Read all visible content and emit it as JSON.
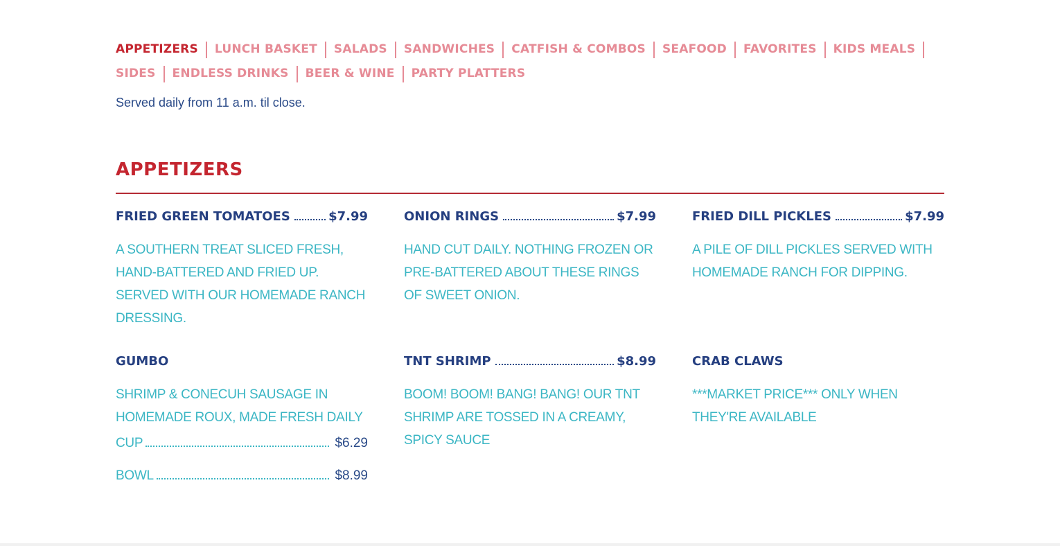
{
  "nav": {
    "row1": [
      {
        "label": "APPETIZERS",
        "active": true
      },
      {
        "label": "LUNCH BASKET"
      },
      {
        "label": "SALADS"
      },
      {
        "label": "SANDWICHES"
      },
      {
        "label": "CATFISH & COMBOS"
      },
      {
        "label": "SEAFOOD"
      },
      {
        "label": "FAVORITES"
      },
      {
        "label": "KIDS MEALS"
      }
    ],
    "row2": [
      {
        "label": "SIDES"
      },
      {
        "label": "ENDLESS DRINKS"
      },
      {
        "label": "BEER & WINE"
      },
      {
        "label": "PARTY PLATTERS"
      }
    ]
  },
  "intro": "Served daily from 11 a.m. til close.",
  "section": {
    "title": "APPETIZERS"
  },
  "items": [
    {
      "name": "FRIED GREEN TOMATOES",
      "price": "$7.99",
      "desc": "A southern treat sliced fresh, hand-battered and fried up. Served with our homemade ranch dressing."
    },
    {
      "name": "ONION RINGS",
      "price": "$7.99",
      "desc": "Hand cut daily. Nothing frozen or pre-battered about these rings of sweet onion."
    },
    {
      "name": "FRIED DILL PICKLES",
      "price": "$7.99",
      "desc": "A pile of dill pickles served with homemade ranch for dipping."
    },
    {
      "name": "GUMBO",
      "price": "",
      "desc": "Shrimp & Conecuh sausage in homemade roux, made fresh daily",
      "sizes": [
        {
          "label": "Cup",
          "price": "$6.29"
        },
        {
          "label": "Bowl",
          "price": "$8.99"
        }
      ]
    },
    {
      "name": "TNT SHRIMP",
      "price": "$8.99",
      "desc": "Boom! Boom! Bang! Bang! Our TNT shrimp are tossed in a creamy, spicy sauce"
    },
    {
      "name": "CRAB CLAWS",
      "price": "",
      "desc": "***Market Price*** Only when they're available"
    }
  ],
  "colors": {
    "accent_red": "#c4252f",
    "nav_pink": "#e68b96",
    "navy": "#253f80",
    "teal": "#3bb6c4"
  }
}
